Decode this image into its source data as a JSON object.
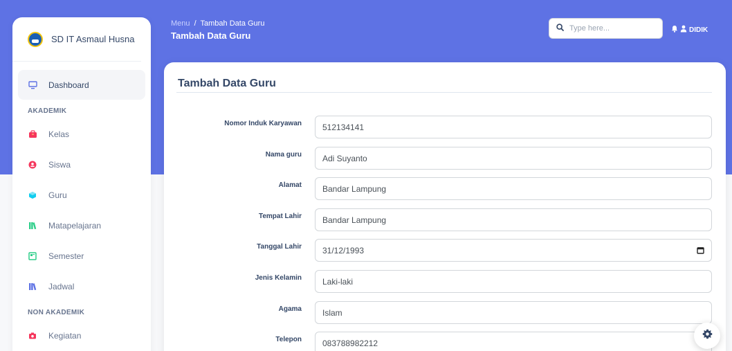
{
  "brand": {
    "name": "SD IT Asmaul Husna"
  },
  "sidebar": {
    "items_top": [
      {
        "label": "Dashboard",
        "icon": "monitor-icon"
      }
    ],
    "section_akademik": "AKADEMIK",
    "akademik": [
      {
        "label": "Kelas",
        "icon": "bag-icon",
        "color": "#f5365c"
      },
      {
        "label": "Siswa",
        "icon": "user-circle-icon",
        "color": "#f5365c"
      },
      {
        "label": "Guru",
        "icon": "cube-icon",
        "color": "#11cdef"
      },
      {
        "label": "Matapelajaran",
        "icon": "books-icon",
        "color": "#2dce89"
      },
      {
        "label": "Semester",
        "icon": "calendar-board-icon",
        "color": "#2dce89"
      },
      {
        "label": "Jadwal",
        "icon": "books-icon",
        "color": "#5e72e4"
      }
    ],
    "section_non_akademik": "NON AKADEMIK",
    "non_akademik": [
      {
        "label": "Kegiatan",
        "icon": "camera-icon",
        "color": "#f5365c"
      }
    ]
  },
  "header": {
    "breadcrumb_root": "Menu",
    "breadcrumb_sep": "/",
    "breadcrumb_current": "Tambah Data Guru",
    "title": "Tambah Data Guru",
    "search_placeholder": "Type here...",
    "user_name": "DIDIK"
  },
  "card": {
    "title": "Tambah Data Guru",
    "fields": [
      {
        "label": "Nomor Induk Karyawan",
        "value": "512134141"
      },
      {
        "label": "Nama guru",
        "value": "Adi Suyanto"
      },
      {
        "label": "Alamat",
        "value": "Bandar Lampung"
      },
      {
        "label": "Tempat Lahir",
        "value": "Bandar Lampung"
      },
      {
        "label": "Tanggal Lahir",
        "value": "31/12/1993"
      },
      {
        "label": "Jenis Kelamin",
        "value": "Laki-laki"
      },
      {
        "label": "Agama",
        "value": "Islam"
      },
      {
        "label": "Telepon",
        "value": "083788982212"
      }
    ]
  },
  "colors": {
    "primary": "#5e72e4",
    "text": "#344767"
  }
}
